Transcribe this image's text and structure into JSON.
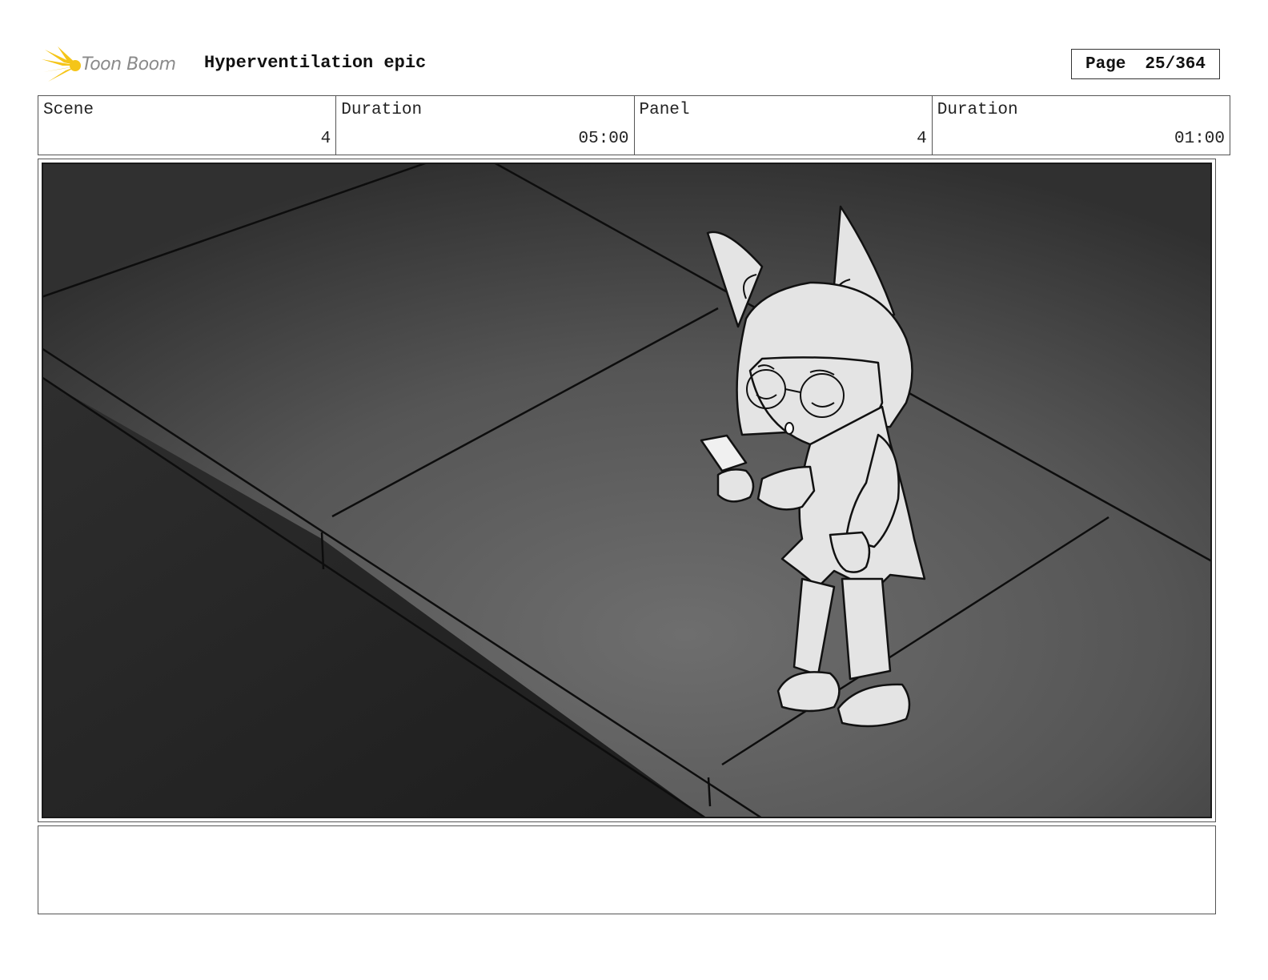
{
  "header": {
    "logo_text": "Toon Boom",
    "project_title": "Hyperventilation epic",
    "page_label": "Page",
    "page_value": "25/364"
  },
  "info": [
    {
      "label": "Scene",
      "value": "4"
    },
    {
      "label": "Duration",
      "value": "05:00"
    },
    {
      "label": "Panel",
      "value": "4"
    },
    {
      "label": "Duration",
      "value": "01:00"
    }
  ],
  "notes": {
    "text": ""
  },
  "colors": {
    "logo_burst": "#f5c518",
    "panel_bg": "#4a4a4a",
    "road_dark": "#252525",
    "character_fill": "#e4e4e4"
  }
}
